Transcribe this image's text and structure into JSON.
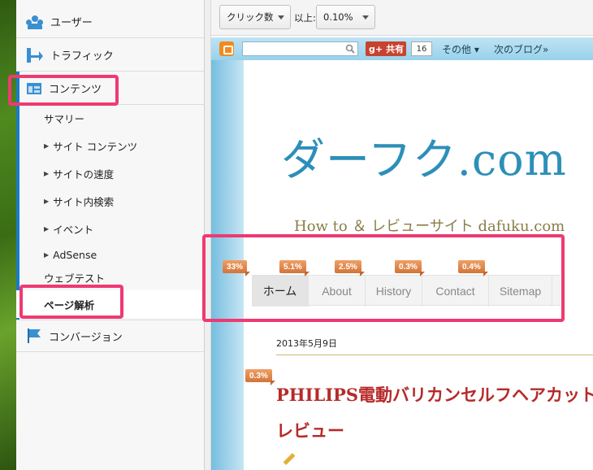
{
  "sidebar": {
    "users": "ユーザー",
    "traffic": "トラフィック",
    "contents": "コンテンツ",
    "summary": "サマリー",
    "site_contents": "サイト コンテンツ",
    "site_speed": "サイトの速度",
    "site_search": "サイト内検索",
    "events": "イベント",
    "adsense": "AdSense",
    "web_test": "ウェブテスト",
    "page_analysis": "ページ解析",
    "conversion": "コンバージョン"
  },
  "toolbar": {
    "metric_select": "クリック数",
    "threshold_label": "以上:",
    "threshold_select": "0.10%"
  },
  "blogbar": {
    "share_label": "共有",
    "share_count": "16",
    "more_label": "その他 ▾",
    "next_blog": "次のブログ»"
  },
  "site": {
    "title": "ダーフク.com",
    "tagline": "How to ＆ レビューサイト dafuku.com",
    "nav": [
      "ホーム",
      "About",
      "History",
      "Contact",
      "Sitemap"
    ],
    "nav_pcts": [
      "33%",
      "5.1%",
      "2.5%",
      "0.3%",
      "0.4%"
    ],
    "date": "2013年5月9日",
    "post_pct": "0.3%",
    "post_title_line1": "PHILIPS電動バリカンセルフヘアカット",
    "post_title_line2": "レビュー"
  },
  "colors": {
    "highlight": "#ee3a72",
    "accent_blue": "#1a7cc4",
    "site_title": "#2d8fb9",
    "post_title": "#b72a2a",
    "badge": "#d2743a"
  }
}
